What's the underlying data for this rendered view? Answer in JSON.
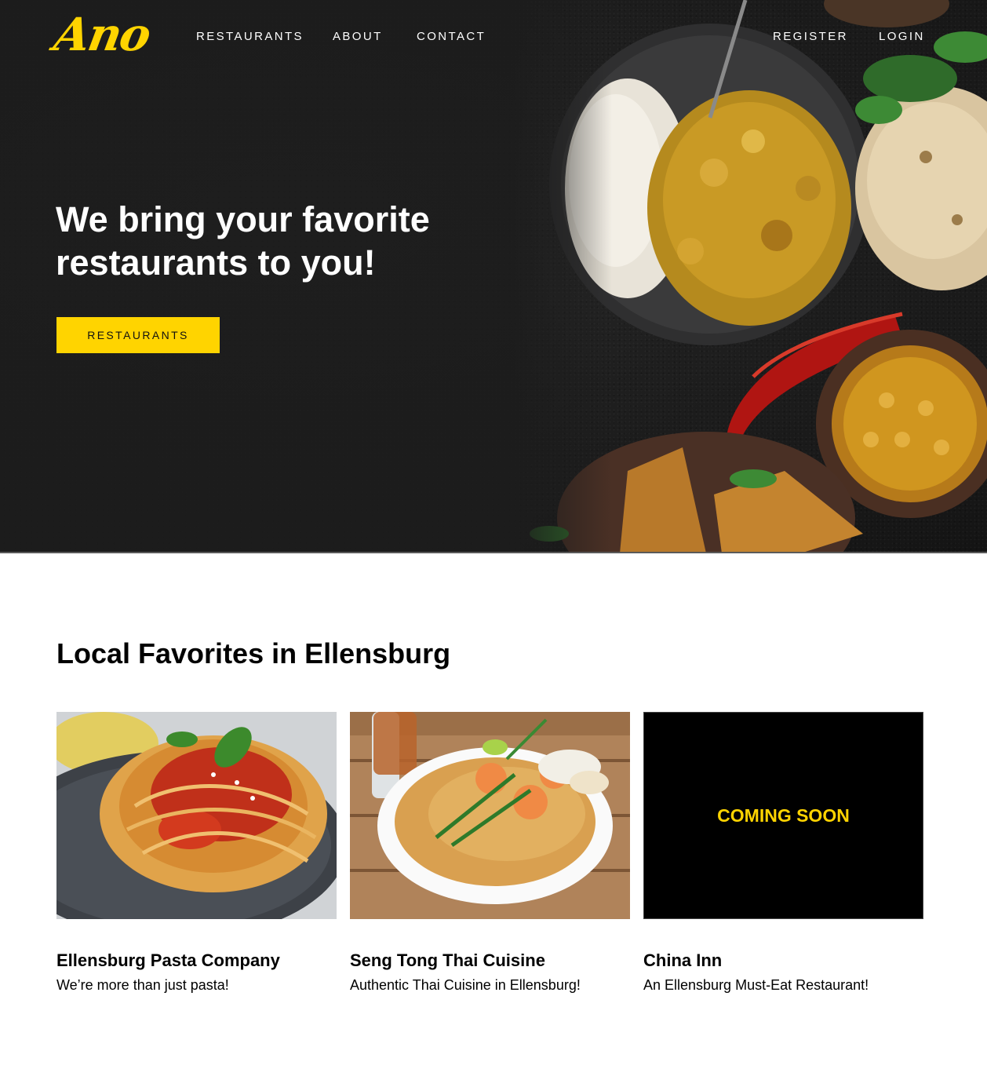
{
  "brand": {
    "logo_text": "Ano",
    "accent_color": "#ffd400"
  },
  "nav": {
    "left": [
      "RESTAURANTS",
      "ABOUT",
      "CONTACT"
    ],
    "right": [
      "REGISTER",
      "LOGIN"
    ]
  },
  "hero": {
    "title": "We bring your favorite restaurants to you!",
    "button_label": "RESTAURANTS"
  },
  "favorites": {
    "title": "Local Favorites in Ellensburg",
    "cards": [
      {
        "name": "Ellensburg Pasta Company",
        "description": "We’re more than just pasta!",
        "image": "spaghetti-plate-photo"
      },
      {
        "name": "Seng Tong Thai Cuisine",
        "description": "Authentic Thai Cuisine in Ellensburg!",
        "image": "pad-thai-plate-photo"
      },
      {
        "name": "China Inn",
        "description": "An Ellensburg Must-Eat Restaurant!",
        "placeholder_text": "COMING SOON"
      }
    ]
  }
}
